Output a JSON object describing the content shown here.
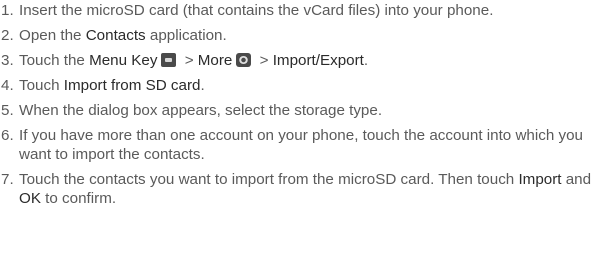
{
  "steps": [
    {
      "num": "1.",
      "parts": [
        "Insert the microSD card (that contains the vCard files) into your phone."
      ]
    },
    {
      "num": "2.",
      "parts": [
        "Open the ",
        "Contacts",
        " application."
      ]
    },
    {
      "num": "3.",
      "parts": [
        "Touch the ",
        "Menu Key",
        " > ",
        "More",
        " > ",
        "Import/Export",
        "."
      ],
      "icons": [
        "menu-key-icon",
        "more-icon"
      ]
    },
    {
      "num": "4.",
      "parts": [
        "Touch ",
        "Import from SD card",
        "."
      ]
    },
    {
      "num": "5.",
      "parts": [
        "When the dialog box appears, select the storage type."
      ]
    },
    {
      "num": "6.",
      "parts": [
        "If you have more than one account on your phone, touch the account into which you want to import the contacts."
      ]
    },
    {
      "num": "7.",
      "parts": [
        "Touch the contacts you want to import from the microSD card. Then touch ",
        "Import",
        " and ",
        "OK",
        " to confirm."
      ]
    }
  ]
}
